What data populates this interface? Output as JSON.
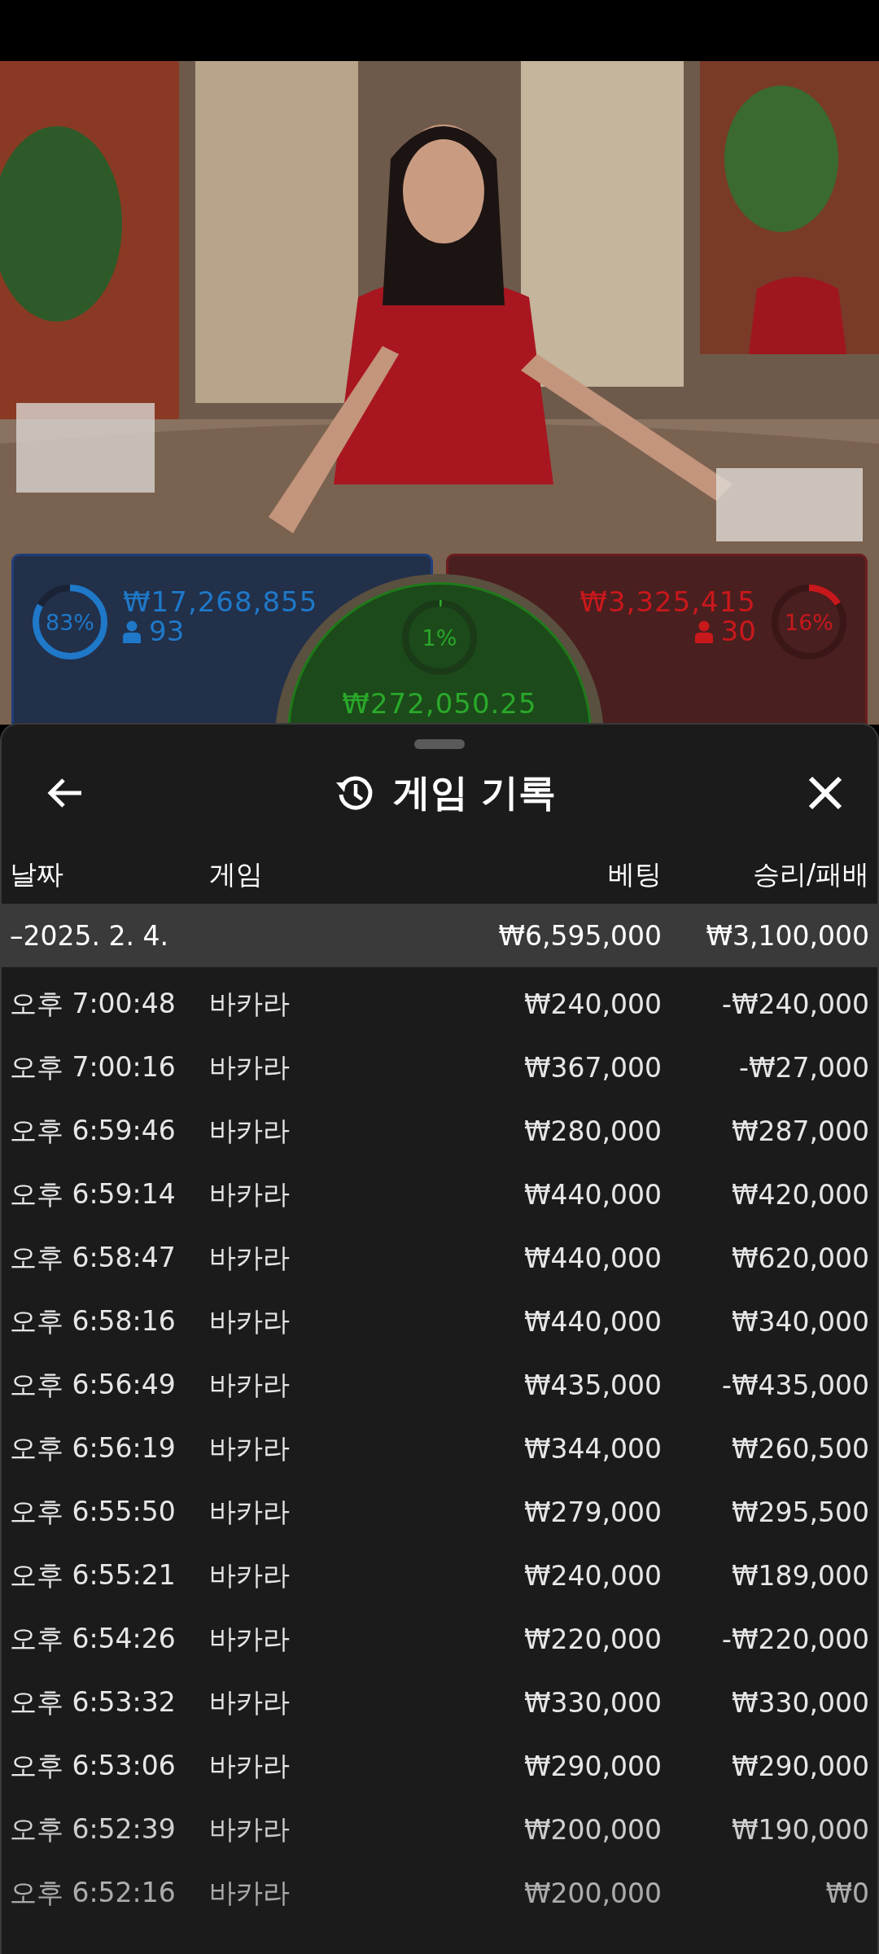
{
  "bets": {
    "player": {
      "amount": "₩17,268,855",
      "players": "93",
      "percent": "83%",
      "level": 0.83
    },
    "tie": {
      "amount": "₩272,050.25",
      "percent": "1%",
      "level": 0.01
    },
    "banker": {
      "amount": "₩3,325,415",
      "players": "30",
      "percent": "16%",
      "level": 0.16
    }
  },
  "sheet": {
    "title": "게임 기록",
    "columns": [
      "날짜",
      "게임",
      "베팅",
      "승리/패배"
    ],
    "date_group": {
      "date": "–2025. 2. 4.",
      "bet": "₩6,595,000",
      "result": "₩3,100,000",
      "expanded": true
    },
    "rows": [
      {
        "time": "오후 7:00:48",
        "game": "바카라",
        "bet": "₩240,000",
        "result": "-₩240,000"
      },
      {
        "time": "오후 7:00:16",
        "game": "바카라",
        "bet": "₩367,000",
        "result": "-₩27,000"
      },
      {
        "time": "오후 6:59:46",
        "game": "바카라",
        "bet": "₩280,000",
        "result": "₩287,000"
      },
      {
        "time": "오후 6:59:14",
        "game": "바카라",
        "bet": "₩440,000",
        "result": "₩420,000"
      },
      {
        "time": "오후 6:58:47",
        "game": "바카라",
        "bet": "₩440,000",
        "result": "₩620,000"
      },
      {
        "time": "오후 6:58:16",
        "game": "바카라",
        "bet": "₩440,000",
        "result": "₩340,000"
      },
      {
        "time": "오후 6:56:49",
        "game": "바카라",
        "bet": "₩435,000",
        "result": "-₩435,000"
      },
      {
        "time": "오후 6:56:19",
        "game": "바카라",
        "bet": "₩344,000",
        "result": "₩260,500"
      },
      {
        "time": "오후 6:55:50",
        "game": "바카라",
        "bet": "₩279,000",
        "result": "₩295,500"
      },
      {
        "time": "오후 6:55:21",
        "game": "바카라",
        "bet": "₩240,000",
        "result": "₩189,000"
      },
      {
        "time": "오후 6:54:26",
        "game": "바카라",
        "bet": "₩220,000",
        "result": "-₩220,000"
      },
      {
        "time": "오후 6:53:32",
        "game": "바카라",
        "bet": "₩330,000",
        "result": "₩330,000"
      },
      {
        "time": "오후 6:53:06",
        "game": "바카라",
        "bet": "₩290,000",
        "result": "₩290,000"
      },
      {
        "time": "오후 6:52:39",
        "game": "바카라",
        "bet": "₩200,000",
        "result": "₩190,000"
      },
      {
        "time": "오후 6:52:16",
        "game": "바카라",
        "bet": "₩200,000",
        "result": "₩0"
      }
    ]
  }
}
